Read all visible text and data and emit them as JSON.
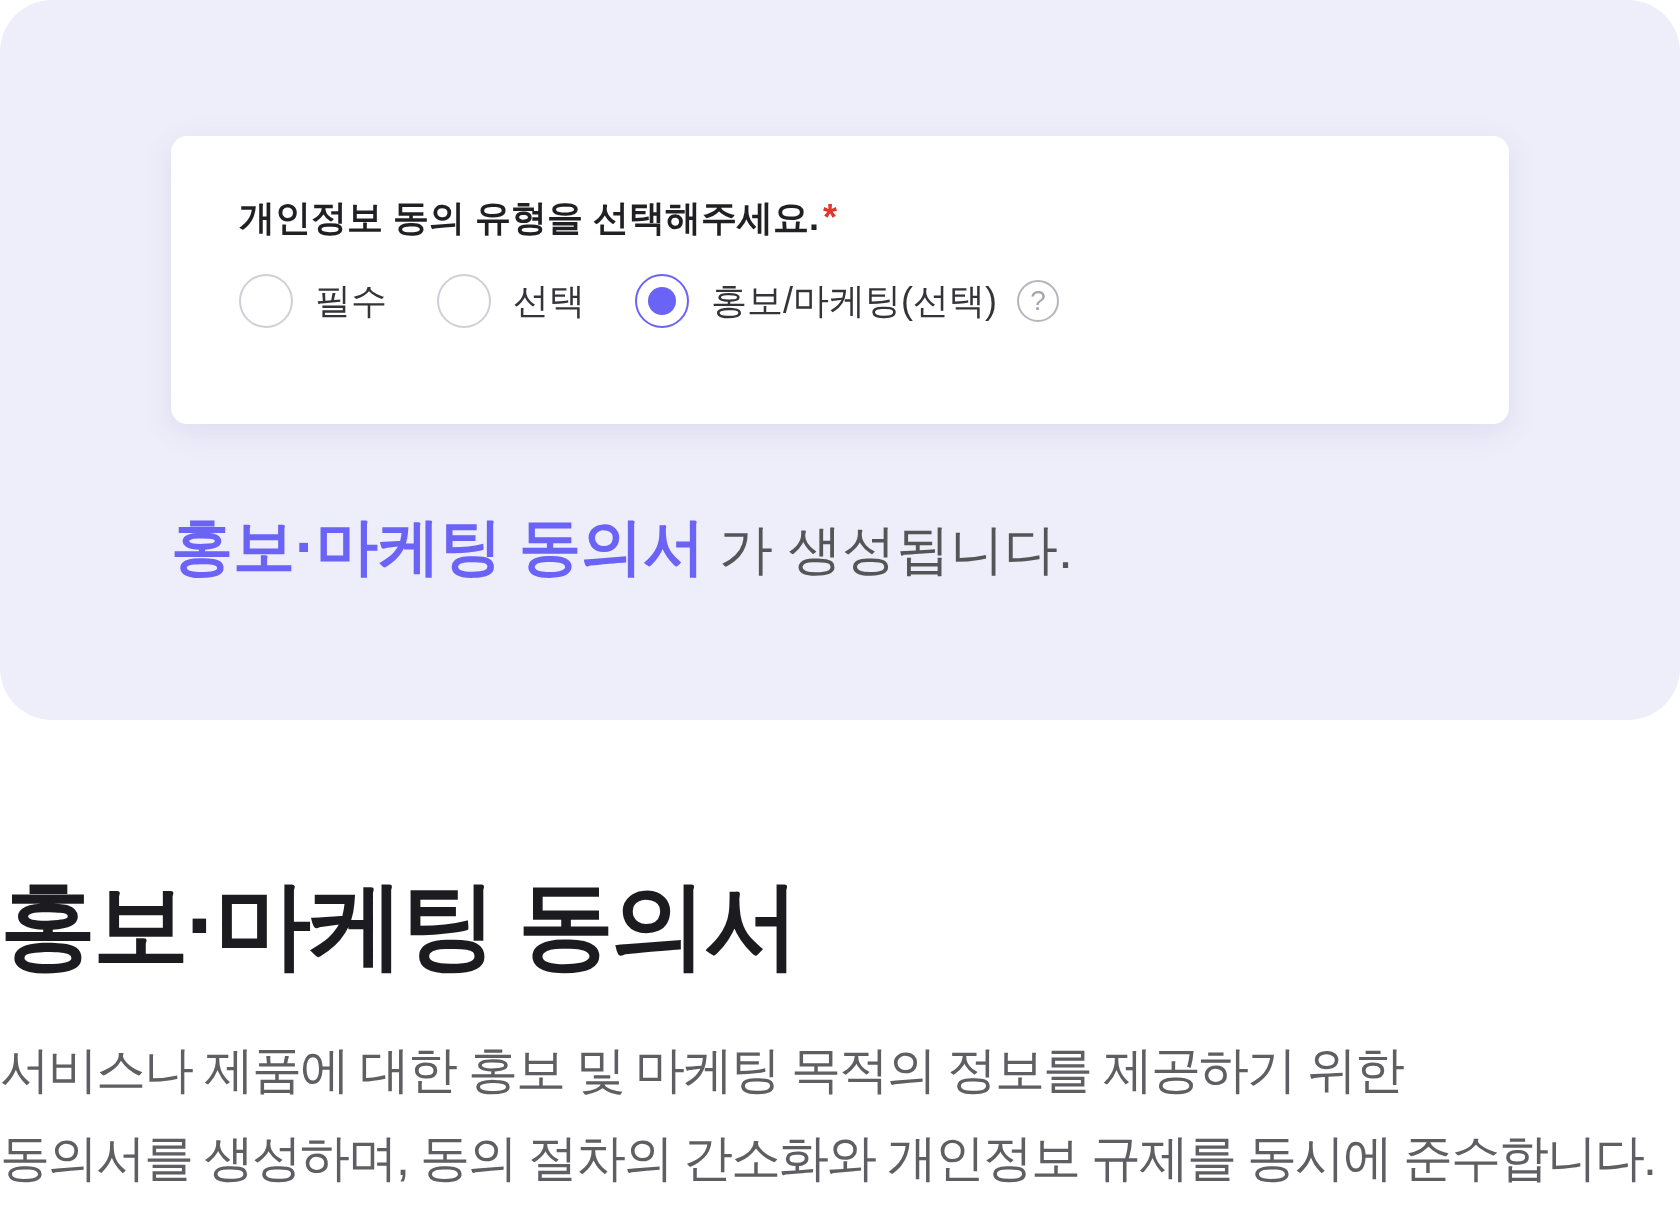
{
  "form": {
    "question": "개인정보 동의 유형을 선택해주세요.",
    "required_mark": "*",
    "options": [
      {
        "label": "필수",
        "selected": false
      },
      {
        "label": "선택",
        "selected": false
      },
      {
        "label": "홍보/마케팅(선택)",
        "selected": true,
        "help": "?"
      }
    ]
  },
  "result": {
    "highlight": "홍보·마케팅 동의서",
    "text": "가 생성됩니다."
  },
  "heading": "홍보·마케팅 동의서",
  "description": [
    "서비스나 제품에 대한 홍보 및 마케팅 목적의 정보를 제공하기 위한",
    "동의서를 생성하며, 동의 절차의 간소화와 개인정보 규제를 동시에 준수합니다."
  ]
}
